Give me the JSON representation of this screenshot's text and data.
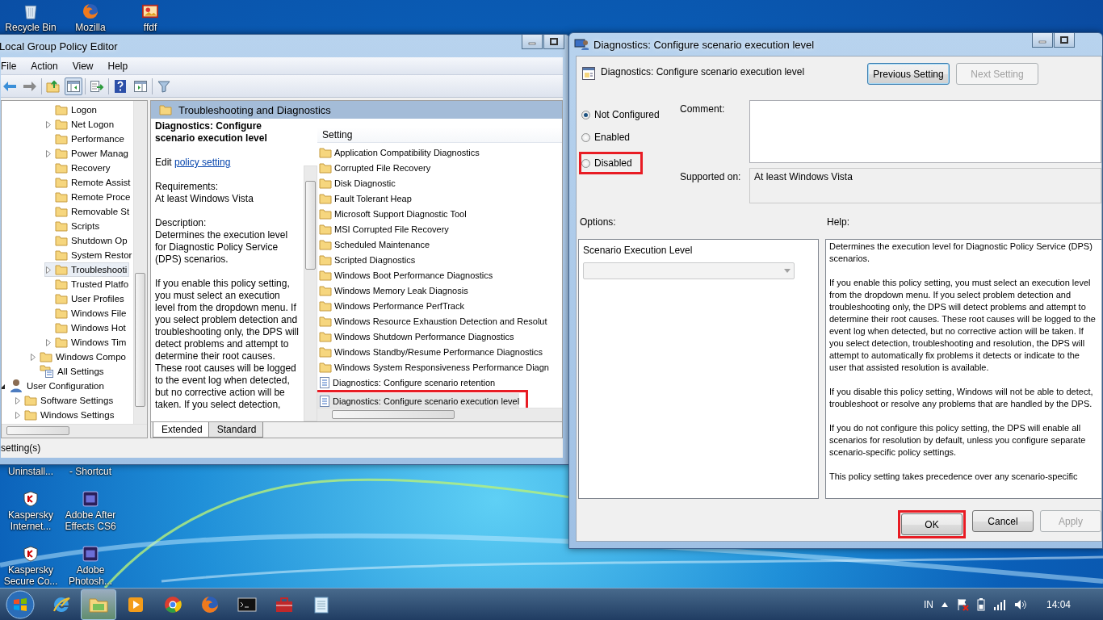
{
  "desktop_icons": [
    {
      "label": "Recycle Bin",
      "kind": "recycle"
    },
    {
      "label": "Mozilla",
      "kind": "firefox"
    },
    {
      "label": "ffdf",
      "kind": "image"
    }
  ],
  "desktop_icons_lower": [
    {
      "label": "Uninstall...",
      "kind": "hidden"
    },
    {
      "label": "- Shortcut",
      "kind": "hidden"
    },
    {
      "label": "Kaspersky\nInternet...",
      "kind": "kaspersky"
    },
    {
      "label": "Adobe After\nEffects CS6",
      "kind": "adobe"
    },
    {
      "label": "Kaspersky\nSecure Co...",
      "kind": "kaspersky"
    },
    {
      "label": "Adobe\nPhotosh...",
      "kind": "adobe"
    }
  ],
  "main_window": {
    "title": "Local Group Policy Editor",
    "menu": [
      "File",
      "Action",
      "View",
      "Help"
    ],
    "toolbar": [
      {
        "kind": "back",
        "pressed": false
      },
      {
        "kind": "forward",
        "pressed": false
      },
      {
        "kind": "sep"
      },
      {
        "kind": "up",
        "pressed": false
      },
      {
        "kind": "pane",
        "pressed": true
      },
      {
        "kind": "sep"
      },
      {
        "kind": "export",
        "pressed": false
      },
      {
        "kind": "sep"
      },
      {
        "kind": "help",
        "pressed": false
      },
      {
        "kind": "view",
        "pressed": false
      },
      {
        "kind": "sep"
      },
      {
        "kind": "filter",
        "pressed": false
      }
    ],
    "tree": {
      "items": [
        {
          "children": [
            {
              "children": [
                {
                  "children": [
                    {
                      "label": "Logon",
                      "kind": "folder",
                      "selected": false
                    },
                    {
                      "label": "Net Logon",
                      "kind": "folder",
                      "expanded": false,
                      "selected": false
                    },
                    {
                      "label": "Performance",
                      "kind": "folder",
                      "selected": false
                    },
                    {
                      "label": "Power Manag",
                      "kind": "folder",
                      "expanded": false,
                      "selected": false
                    },
                    {
                      "label": "Recovery",
                      "kind": "folder",
                      "selected": false
                    },
                    {
                      "label": "Remote Assist",
                      "kind": "folder",
                      "selected": false
                    },
                    {
                      "label": "Remote Proce",
                      "kind": "folder",
                      "selected": false
                    },
                    {
                      "label": "Removable St",
                      "kind": "folder",
                      "selected": false
                    },
                    {
                      "label": "Scripts",
                      "kind": "folder",
                      "selected": false
                    },
                    {
                      "label": "Shutdown Op",
                      "kind": "folder",
                      "selected": false
                    },
                    {
                      "label": "System Restor",
                      "kind": "folder",
                      "selected": false
                    },
                    {
                      "label": "Troubleshooti",
                      "kind": "folder",
                      "expanded": false,
                      "selected": true
                    },
                    {
                      "label": "Trusted Platfo",
                      "kind": "folder",
                      "selected": false
                    },
                    {
                      "label": "User Profiles",
                      "kind": "folder",
                      "selected": false
                    },
                    {
                      "label": "Windows File",
                      "kind": "folder",
                      "selected": false
                    },
                    {
                      "label": "Windows Hot",
                      "kind": "folder",
                      "selected": false
                    },
                    {
                      "label": "Windows Tim",
                      "kind": "folder",
                      "expanded": false,
                      "selected": false
                    }
                  ]
                },
                {
                  "label": "Windows Compo",
                  "kind": "folder",
                  "expanded": false,
                  "selected": false
                },
                {
                  "label": "All Settings",
                  "kind": "settings",
                  "selected": false
                }
              ]
            }
          ]
        },
        {
          "label": "User Configuration",
          "kind": "user",
          "expanded": true,
          "selected": false,
          "children": [
            {
              "label": "Software Settings",
              "kind": "folder",
              "expanded": false,
              "selected": false
            },
            {
              "label": "Windows Settings",
              "kind": "folder",
              "expanded": false,
              "selected": false
            }
          ]
        }
      ]
    },
    "pane_header": "Troubleshooting and Diagnostics",
    "description": {
      "title": "Diagnostics: Configure scenario execution level",
      "edit_prefix": "Edit",
      "edit_link": "policy setting",
      "requirements_label": "Requirements:",
      "requirements": "At least Windows Vista",
      "description_label": "Description:",
      "paragraphs": [
        "Determines the execution level for Diagnostic Policy Service (DPS) scenarios.",
        "If you enable this policy setting, you must select an execution level from the dropdown menu.  If you select problem detection and troubleshooting only, the DPS will detect problems and attempt to determine their root causes. These root causes will be logged to the event log when detected, but no corrective action will be taken.  If you select detection,"
      ]
    },
    "list": {
      "columns": [
        "Setting"
      ],
      "rows": [
        {
          "label": "Application Compatibility Diagnostics",
          "kind": "folder",
          "selected": false,
          "highlighted": false
        },
        {
          "label": "Corrupted File Recovery",
          "kind": "folder",
          "selected": false,
          "highlighted": false
        },
        {
          "label": "Disk Diagnostic",
          "kind": "folder",
          "selected": false,
          "highlighted": false
        },
        {
          "label": "Fault Tolerant Heap",
          "kind": "folder",
          "selected": false,
          "highlighted": false
        },
        {
          "label": "Microsoft Support Diagnostic Tool",
          "kind": "folder",
          "selected": false,
          "highlighted": false
        },
        {
          "label": "MSI Corrupted File Recovery",
          "kind": "folder",
          "selected": false,
          "highlighted": false
        },
        {
          "label": "Scheduled Maintenance",
          "kind": "folder",
          "selected": false,
          "highlighted": false
        },
        {
          "label": "Scripted Diagnostics",
          "kind": "folder",
          "selected": false,
          "highlighted": false
        },
        {
          "label": "Windows Boot Performance Diagnostics",
          "kind": "folder",
          "selected": false,
          "highlighted": false
        },
        {
          "label": "Windows Memory Leak Diagnosis",
          "kind": "folder",
          "selected": false,
          "highlighted": false
        },
        {
          "label": "Windows Performance PerfTrack",
          "kind": "folder",
          "selected": false,
          "highlighted": false
        },
        {
          "label": "Windows Resource Exhaustion Detection and Resolut",
          "kind": "folder",
          "selected": false,
          "highlighted": false
        },
        {
          "label": "Windows Shutdown Performance Diagnostics",
          "kind": "folder",
          "selected": false,
          "highlighted": false
        },
        {
          "label": "Windows Standby/Resume Performance Diagnostics",
          "kind": "folder",
          "selected": false,
          "highlighted": false
        },
        {
          "label": "Windows System Responsiveness Performance Diagn",
          "kind": "folder",
          "selected": false,
          "highlighted": false
        },
        {
          "label": "Diagnostics: Configure scenario retention",
          "kind": "policy",
          "selected": false,
          "highlighted": false
        },
        {
          "label": "Diagnostics: Configure scenario execution level",
          "kind": "policy",
          "selected": true,
          "highlighted": true
        }
      ]
    },
    "tabs": [
      {
        "label": "Extended",
        "selected": true
      },
      {
        "label": "Standard",
        "selected": false
      }
    ],
    "status_bar": "setting(s)"
  },
  "dialog": {
    "title": "Diagnostics: Configure scenario execution level",
    "heading": "Diagnostics: Configure scenario execution level",
    "nav_buttons": [
      {
        "label": "Previous Setting",
        "disabled": false
      },
      {
        "label": "Next Setting",
        "disabled": true
      }
    ],
    "states": [
      {
        "label": "Not Configured",
        "selected": true,
        "highlighted": false
      },
      {
        "label": "Enabled",
        "selected": false,
        "highlighted": false
      },
      {
        "label": "Disabled",
        "selected": false,
        "highlighted": true
      }
    ],
    "comment_label": "Comment:",
    "supported_label": "Supported on:",
    "supported_value": "At least Windows Vista",
    "options_label": "Options:",
    "help_label": "Help:",
    "options": {
      "label": "Scenario Execution Level",
      "dropdown": {
        "disabled": true
      }
    },
    "help": [
      "Determines the execution level for Diagnostic Policy Service (DPS) scenarios.",
      "If you enable this policy setting, you must select an execution level from the dropdown menu.  If you select problem detection and troubleshooting only, the DPS will detect problems and attempt to determine their root causes.  These root causes will be logged to the event log when detected, but no corrective action will be taken.  If you select detection, troubleshooting and resolution, the DPS will attempt to automatically fix problems it detects or indicate to the user that assisted resolution is available.",
      "If you disable this policy setting, Windows will not be able to detect, troubleshoot or resolve any problems that are handled by the DPS.",
      "If you do not configure this policy setting, the DPS will enable all scenarios for resolution by default, unless you configure separate scenario-specific policy settings.",
      "This policy setting takes precedence over any scenario-specific"
    ],
    "buttons": [
      {
        "label": "OK",
        "disabled": false,
        "highlighted": true
      },
      {
        "label": "Cancel",
        "disabled": false,
        "highlighted": false
      },
      {
        "label": "Apply",
        "disabled": true,
        "highlighted": false
      }
    ]
  },
  "taskbar": {
    "items": [
      {
        "kind": "ie",
        "selected": false
      },
      {
        "kind": "explorer",
        "selected": true
      },
      {
        "kind": "media",
        "selected": false
      },
      {
        "kind": "chrome",
        "selected": false
      },
      {
        "kind": "firefox",
        "selected": false
      },
      {
        "kind": "cmd",
        "selected": false
      },
      {
        "kind": "toolbox",
        "selected": false
      },
      {
        "kind": "notepad",
        "selected": false
      }
    ],
    "language": "IN",
    "clock": "14:04"
  }
}
